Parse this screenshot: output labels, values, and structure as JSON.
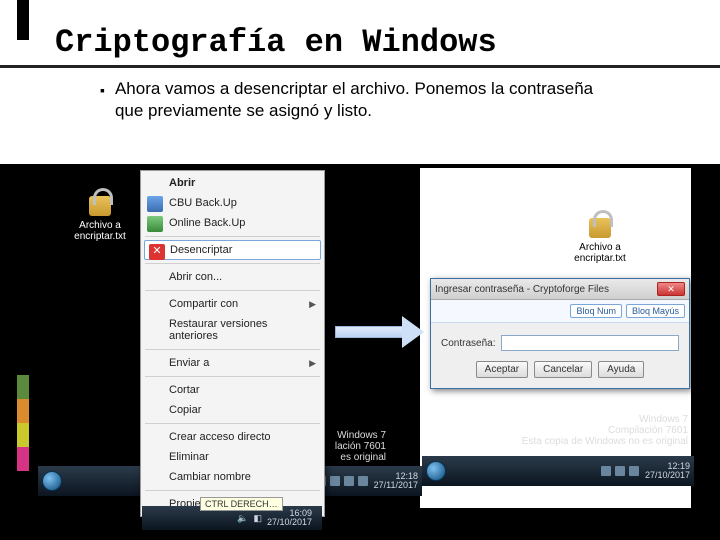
{
  "title": "Criptografía en Windows",
  "bullet": "Ahora vamos a desencriptar el archivo. Ponemos la contraseña que previamente se asignó y listo.",
  "left_icon_label": "Archivo a encriptar.txt",
  "right_icon_label": "Archivo a encriptar.txt",
  "context_menu": {
    "open": "Abrir",
    "cbu": "CBU Back.Up",
    "online": "Online Back.Up",
    "desencriptar": "Desencriptar",
    "abrir_con": "Abrir con...",
    "compartir": "Compartir con",
    "restaurar": "Restaurar versiones anteriores",
    "enviar": "Enviar a",
    "cortar": "Cortar",
    "copiar": "Copiar",
    "acceso": "Crear acceso directo",
    "eliminar": "Eliminar",
    "cambiar": "Cambiar nombre",
    "propiedades": "Propiedades"
  },
  "dialog": {
    "title": "Ingresar contraseña - Cryptoforge Files",
    "tbtn1": "Bloq Num",
    "tbtn2": "Bloq Mayús",
    "label": "Contraseña:",
    "ok": "Aceptar",
    "cancel": "Cancelar",
    "help": "Ayuda"
  },
  "watermark_left": {
    "l1": "Windows 7",
    "l2": "lación 7601",
    "l3": "es original"
  },
  "watermark_right": {
    "l1": "Windows 7",
    "l2": "Compilación 7601",
    "l3": "Esta copia de Windows no es original"
  },
  "clock1": {
    "time": "12:18",
    "date": "27/11/2017"
  },
  "clock2": {
    "time": "12:19",
    "date": "27/10/2017"
  },
  "clock3": {
    "time": "16:09",
    "date": "27/10/2017"
  },
  "tooltip": "CTRL DERECH…"
}
